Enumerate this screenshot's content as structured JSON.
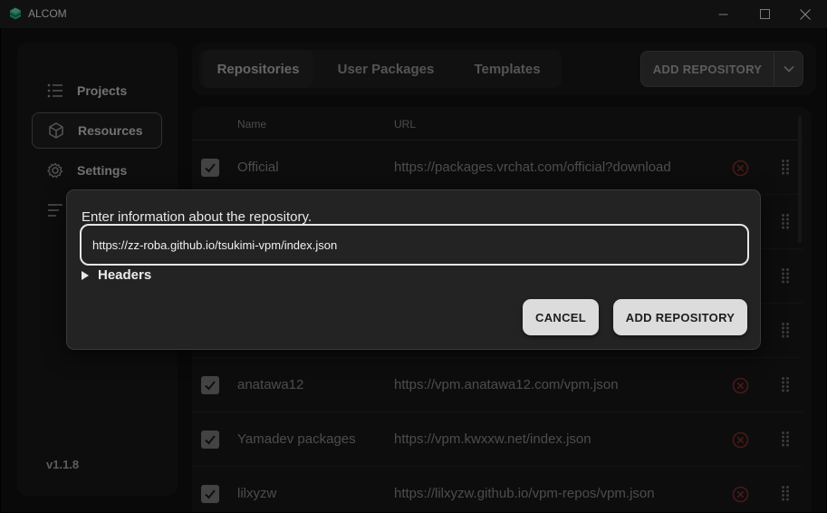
{
  "window": {
    "title": "ALCOM"
  },
  "sidebar": {
    "items": [
      {
        "label": "Projects",
        "icon": "list-icon"
      },
      {
        "label": "Resources",
        "icon": "cube-icon"
      },
      {
        "label": "Settings",
        "icon": "gear-icon"
      },
      {
        "label": "",
        "icon": "log-lines-icon"
      }
    ],
    "active": "Resources",
    "version": "v1.1.8"
  },
  "tabs": [
    "Repositories",
    "User Packages",
    "Templates"
  ],
  "active_tab": "Repositories",
  "toolbar": {
    "add_repository_label": "ADD REPOSITORY"
  },
  "table": {
    "columns": {
      "name": "Name",
      "url": "URL"
    },
    "rows": [
      {
        "name": "Official",
        "url": "https://packages.vrchat.com/official?download",
        "checked": true
      },
      {
        "name": "",
        "url": "",
        "checked": true
      },
      {
        "name": "",
        "url": "",
        "checked": true
      },
      {
        "name": "",
        "url": "",
        "checked": true
      },
      {
        "name": "anatawa12",
        "url": "https://vpm.anatawa12.com/vpm.json",
        "checked": true
      },
      {
        "name": "Yamadev packages",
        "url": "https://vpm.kwxxw.net/index.json",
        "checked": true
      },
      {
        "name": "lilxyzw",
        "url": "https://lilxyzw.github.io/vpm-repos/vpm.json",
        "checked": true
      }
    ]
  },
  "dialog": {
    "prompt": "Enter information about the repository.",
    "url_value": "https://zz-roba.github.io/tsukimi-vpm/index.json",
    "headers_label": "Headers",
    "cancel_label": "CANCEL",
    "add_label": "ADD REPOSITORY"
  },
  "colors": {
    "accent": "#dcdcdc",
    "danger": "#a33a3a",
    "background": "#111111"
  }
}
